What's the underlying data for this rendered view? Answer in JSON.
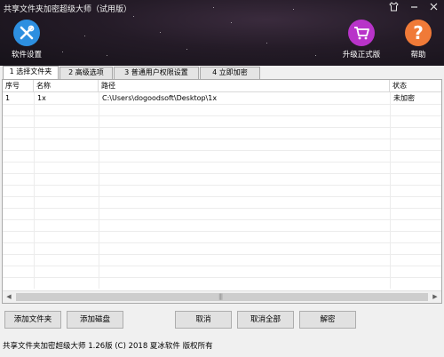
{
  "window": {
    "title": "共享文件夹加密超级大师（试用版）"
  },
  "toolbar": {
    "settings_label": "软件设置",
    "upgrade_label": "升级正式版",
    "help_label": "帮助"
  },
  "tabs": [
    {
      "label": "1 选择文件夹",
      "active": true
    },
    {
      "label": "2 高级选项",
      "active": false
    },
    {
      "label": "3 普通用户权限设置",
      "active": false
    },
    {
      "label": "4 立即加密",
      "active": false
    }
  ],
  "table": {
    "columns": [
      "序号",
      "名称",
      "路径",
      "状态"
    ],
    "rows": [
      {
        "index": "1",
        "name": "1x",
        "path": "C:\\Users\\dogoodsoft\\Desktop\\1x",
        "status": "未加密"
      }
    ]
  },
  "buttons": {
    "add_folder": "添加文件夹",
    "add_disk": "添加磁盘",
    "cancel": "取消",
    "cancel_all": "取消全部",
    "decrypt": "解密"
  },
  "status_bar": {
    "text": "共享文件夹加密超级大师 1.26版  (C) 2018 夏冰软件 版权所有"
  },
  "colors": {
    "settings_icon": "#2d8fe0",
    "upgrade_icon": "#b833c9",
    "help_icon": "#f07a38"
  }
}
